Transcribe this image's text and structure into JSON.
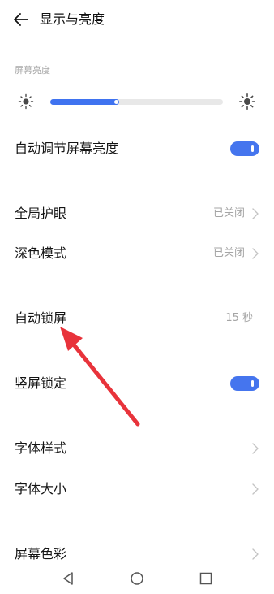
{
  "header": {
    "title": "显示与亮度"
  },
  "brightness": {
    "section_label": "屏幕亮度",
    "level_percent": 40
  },
  "settings": {
    "auto_brightness": {
      "label": "自动调节屏幕亮度",
      "enabled": true
    },
    "eye_protection": {
      "label": "全局护眼",
      "value": "已关闭"
    },
    "dark_mode": {
      "label": "深色模式",
      "value": "已关闭"
    },
    "auto_lock": {
      "label": "自动锁屏",
      "value": "15 秒"
    },
    "portrait_lock": {
      "label": "竖屏锁定",
      "enabled": true
    },
    "font_style": {
      "label": "字体样式"
    },
    "font_size": {
      "label": "字体大小"
    },
    "screen_color": {
      "label": "屏幕色彩"
    }
  },
  "colors": {
    "accent": "#4575ee",
    "annotation_arrow": "#e8333b"
  },
  "icons": [
    "back-arrow-icon",
    "sun-icon",
    "chevron-right-icon",
    "nav-back-icon",
    "nav-home-icon",
    "nav-recents-icon"
  ]
}
